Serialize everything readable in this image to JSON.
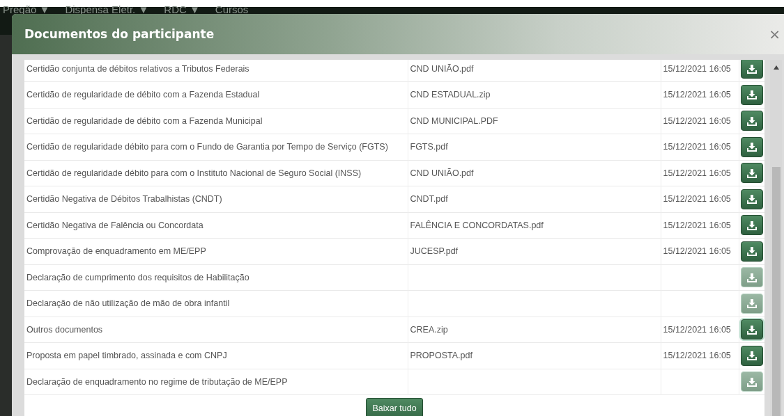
{
  "nav": [
    {
      "label": "Pregão",
      "caret": "▼"
    },
    {
      "label": "Dispensa Eletr.",
      "caret": "▼"
    },
    {
      "label": "RDC",
      "caret": "▼"
    },
    {
      "label": "Cursos"
    }
  ],
  "modal": {
    "title": "Documentos do participante",
    "close": "×"
  },
  "documents": [
    {
      "name": "Certidão conjunta de débitos relativos a Tributos Federais",
      "file": "CND UNIÃO.pdf",
      "date": "15/12/2021 16:05",
      "disabled": false,
      "focused": false
    },
    {
      "name": "Certidão de regularidade de débito com a Fazenda Estadual",
      "file": "CND ESTADUAL.zip",
      "date": "15/12/2021 16:05",
      "disabled": false,
      "focused": false
    },
    {
      "name": "Certidão de regularidade de débito com a Fazenda Municipal",
      "file": "CND MUNICIPAL.PDF",
      "date": "15/12/2021 16:05",
      "disabled": false,
      "focused": false
    },
    {
      "name": "Certidão de regularidade débito para com o Fundo de Garantia por Tempo de Serviço (FGTS)",
      "file": "FGTS.pdf",
      "date": "15/12/2021 16:05",
      "disabled": false,
      "focused": false
    },
    {
      "name": "Certidão de regularidade débito para com o Instituto Nacional de Seguro Social (INSS)",
      "file": "CND UNIÃO.pdf",
      "date": "15/12/2021 16:05",
      "disabled": false,
      "focused": false
    },
    {
      "name": "Certidão Negativa de Débitos Trabalhistas (CNDT)",
      "file": "CNDT.pdf",
      "date": "15/12/2021 16:05",
      "disabled": false,
      "focused": false
    },
    {
      "name": "Certidão Negativa de Falência ou Concordata",
      "file": "FALÊNCIA E CONCORDATAS.pdf",
      "date": "15/12/2021 16:05",
      "disabled": false,
      "focused": false
    },
    {
      "name": "Comprovação de enquadramento em ME/EPP",
      "file": "JUCESP.pdf",
      "date": "15/12/2021 16:05",
      "disabled": false,
      "focused": false
    },
    {
      "name": "Declaração de cumprimento dos requisitos de Habilitação",
      "disabled": true,
      "focused": false
    },
    {
      "name": "Declaração de não utilização de mão de obra infantil",
      "disabled": true,
      "focused": false
    },
    {
      "name": "Outros documentos",
      "file": "CREA.zip",
      "date": "15/12/2021 16:05",
      "disabled": false,
      "focused": true
    },
    {
      "name": "Proposta em papel timbrado, assinada e com CNPJ",
      "file": "PROPOSTA.pdf",
      "date": "15/12/2021 16:05",
      "disabled": false,
      "focused": false
    },
    {
      "name": "Declaração de enquadramento no regime de tributação de ME/EPP",
      "disabled": true,
      "focused": false
    }
  ],
  "download_all": "Baixar tudo"
}
